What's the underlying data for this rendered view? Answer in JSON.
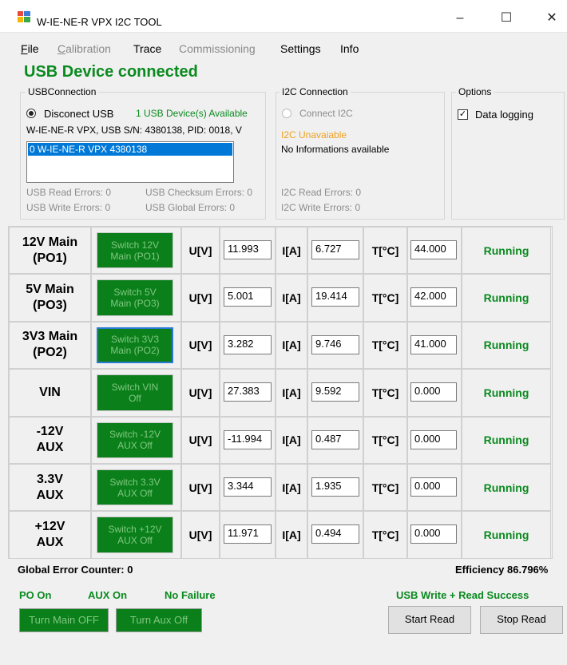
{
  "window": {
    "title": "W-IE-NE-R VPX I2C TOOL",
    "minimize": "–",
    "maximize": "☐",
    "close": "✕"
  },
  "menu": [
    {
      "label": "File",
      "underline": "F",
      "rest": "ile",
      "enabled": true
    },
    {
      "label": "Calibration",
      "underline": "C",
      "rest": "alibration",
      "enabled": false
    },
    {
      "label": "Trace",
      "enabled": true
    },
    {
      "label": "Commissioning",
      "enabled": false
    },
    {
      "label": "Settings",
      "enabled": true
    },
    {
      "label": "Info",
      "enabled": true
    }
  ],
  "status": "USB Device connected",
  "usb": {
    "group_title": "USBConnection",
    "disconnect_label": "Disconect USB",
    "available": "1 USB Device(s) Available",
    "info": "W-IE-NE-R VPX, USB S/N: 4380138, PID: 0018, V",
    "list_selected": "0 W-IE-NE-R VPX 4380138",
    "read_errors": "USB Read Errors: 0",
    "checksum_errors": "USB Checksum Errors: 0",
    "write_errors": "USB Write Errors: 0",
    "global_errors": "USB Global Errors: 0"
  },
  "i2c": {
    "group_title": "I2C Connection",
    "connect_label": "Connect I2C",
    "unavailable": "I2C Unavaiable",
    "info": "No Informations available",
    "read_errors": "I2C Read Errors: 0",
    "write_errors": "I2C Write Errors: 0"
  },
  "options": {
    "group_title": "Options",
    "data_logging": "Data logging",
    "data_logging_checked": true
  },
  "labels": {
    "u": "U[V]",
    "i": "I[A]",
    "t": "T[°C]"
  },
  "rows": [
    {
      "name1": "12V Main",
      "name2": "(PO1)",
      "sw1": "Switch 12V",
      "sw2": "Main (PO1)",
      "u": "11.993",
      "i": "6.727",
      "t": "44.000",
      "state": "Running"
    },
    {
      "name1": "5V Main",
      "name2": "(PO3)",
      "sw1": "Switch 5V",
      "sw2": "Main (PO3)",
      "u": "5.001",
      "i": "19.414",
      "t": "42.000",
      "state": "Running"
    },
    {
      "name1": "3V3 Main",
      "name2": "(PO2)",
      "sw1": "Switch 3V3",
      "sw2": "Main (PO2)",
      "u": "3.282",
      "i": "9.746",
      "t": "41.000",
      "state": "Running"
    },
    {
      "name1": "VIN",
      "name2": "",
      "sw1": "Switch VIN",
      "sw2": "Off",
      "u": "27.383",
      "i": "9.592",
      "t": "0.000",
      "state": "Running"
    },
    {
      "name1": "-12V",
      "name2": "AUX",
      "sw1": "Switch -12V",
      "sw2": "AUX Off",
      "u": "-11.994",
      "i": "0.487",
      "t": "0.000",
      "state": "Running"
    },
    {
      "name1": "3.3V",
      "name2": "AUX",
      "sw1": "Switch 3.3V",
      "sw2": "AUX Off",
      "u": "3.344",
      "i": "1.935",
      "t": "0.000",
      "state": "Running"
    },
    {
      "name1": "+12V",
      "name2": "AUX",
      "sw1": "Switch +12V",
      "sw2": "AUX Off",
      "u": "11.971",
      "i": "0.494",
      "t": "0.000",
      "state": "Running"
    }
  ],
  "footer": {
    "global_error": "Global Error Counter: 0",
    "efficiency": "Efficiency 86.796%",
    "po_on": "PO On",
    "aux_on": "AUX On",
    "no_failure": "No Failure",
    "usb_success": "USB Write + Read Success",
    "turn_main_off": "Turn Main OFF",
    "turn_aux_off": "Turn Aux Off",
    "start_read": "Start Read",
    "stop_read": "Stop Read"
  }
}
